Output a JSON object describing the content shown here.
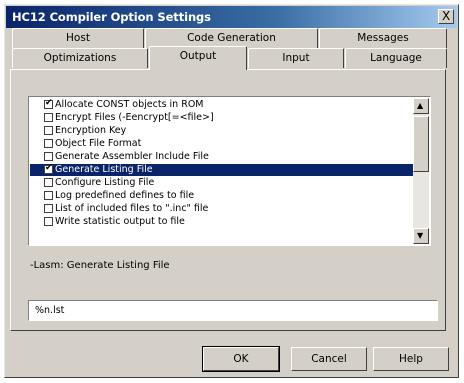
{
  "window": {
    "title": "HC12 Compiler Option Settings",
    "close_glyph": "X"
  },
  "tabs_back": [
    {
      "label": "Host"
    },
    {
      "label": "Code Generation"
    },
    {
      "label": "Messages"
    }
  ],
  "tabs_front": [
    {
      "label": "Optimizations"
    },
    {
      "label": "Output",
      "selected": true
    },
    {
      "label": "Input"
    },
    {
      "label": "Language"
    }
  ],
  "options": [
    {
      "label": "Allocate CONST objects in ROM",
      "checked": true
    },
    {
      "label": "Encrypt Files (-Eencrypt[=<file>]",
      "checked": false
    },
    {
      "label": "Encryption Key",
      "checked": false
    },
    {
      "label": "Object File Format",
      "checked": false
    },
    {
      "label": "Generate Assembler Include File",
      "checked": false
    },
    {
      "label": "Generate Listing File",
      "checked": true,
      "selected": true
    },
    {
      "label": "Configure Listing File",
      "checked": false
    },
    {
      "label": "Log predefined defines to file",
      "checked": false
    },
    {
      "label": "List of included files to \".inc\" file",
      "checked": false
    },
    {
      "label": "Write statistic output to file",
      "checked": false
    }
  ],
  "check_glyph": "✔",
  "scroll": {
    "up_glyph": "▲",
    "down_glyph": "▼"
  },
  "description": "-Lasm: Generate Listing File",
  "param_input": {
    "value": "%n.lst"
  },
  "buttons": {
    "ok": "OK",
    "cancel": "Cancel",
    "help": "Help"
  }
}
